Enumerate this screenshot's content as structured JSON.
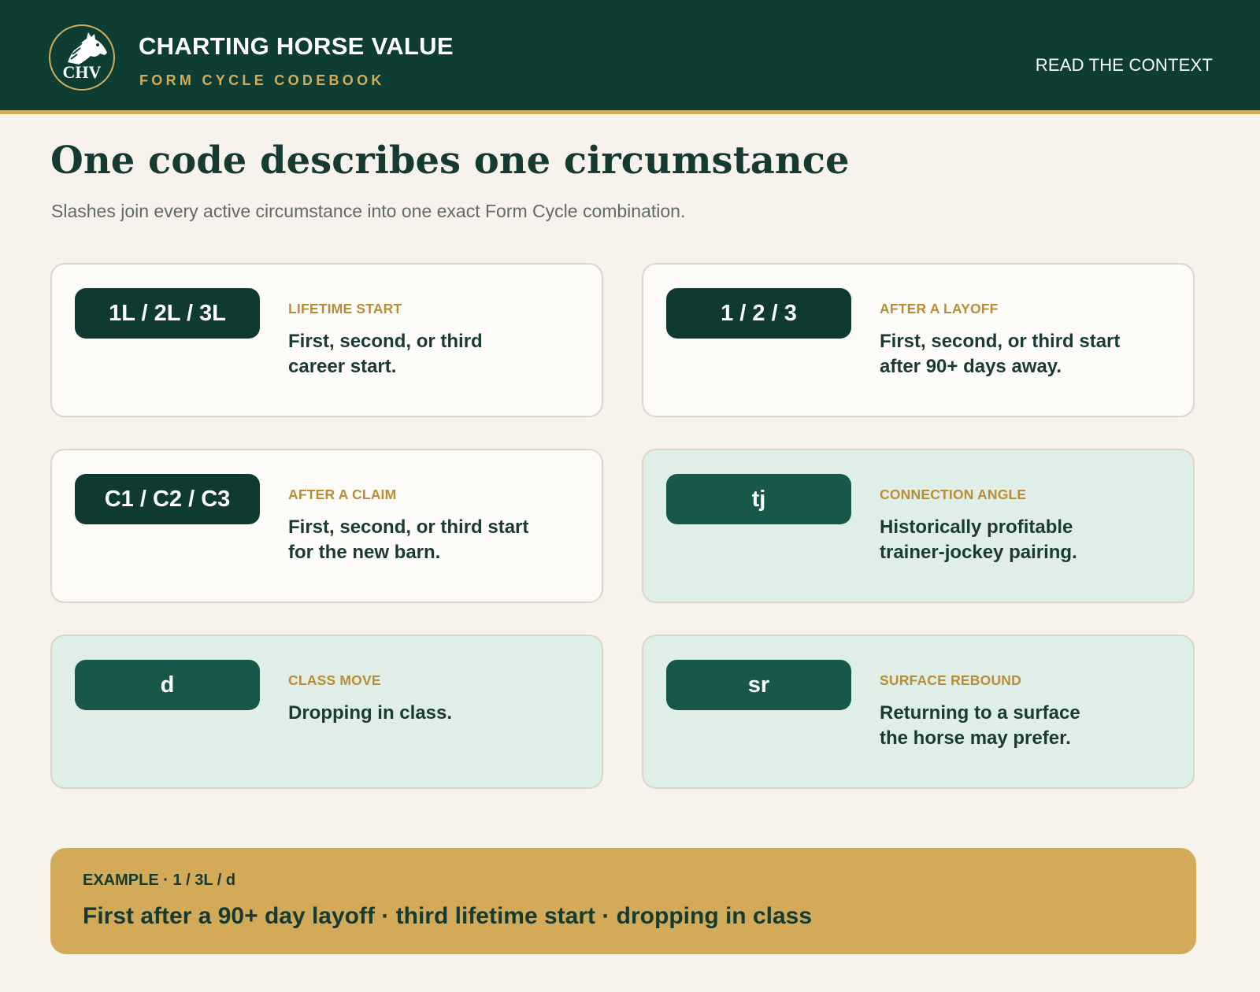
{
  "header": {
    "logo_text": "CHV",
    "title": "CHARTING HORSE VALUE",
    "subtitle": "FORM CYCLE CODEBOOK",
    "nav_link": "READ THE CONTEXT"
  },
  "main": {
    "title": "One code describes one circumstance",
    "subtitle": "Slashes join every active circumstance into one exact Form Cycle combination."
  },
  "codes": [
    {
      "code": "1L / 2L / 3L",
      "label": "LIFETIME START",
      "line1": "First, second, or third",
      "line2": "career start."
    },
    {
      "code": "1 / 2 / 3",
      "label": "AFTER A LAYOFF",
      "line1": "First, second, or third start",
      "line2": "after 90+ days away."
    },
    {
      "code": "C1 / C2 / C3",
      "label": "AFTER A CLAIM",
      "line1": "First, second, or third start",
      "line2": "for the new barn."
    },
    {
      "code": "tj",
      "label": "CONNECTION ANGLE",
      "line1": "Historically profitable",
      "line2": "trainer-jockey pairing."
    },
    {
      "code": "d",
      "label": "CLASS MOVE",
      "line1": "Dropping in class.",
      "line2": ""
    },
    {
      "code": "sr",
      "label": "SURFACE REBOUND",
      "line1": "Returning to a surface",
      "line2": "the horse may prefer."
    }
  ],
  "example": {
    "label": "EXAMPLE · 1 / 3L / d",
    "text": "First after a 90+ day layoff · third lifetime start · dropping in class"
  },
  "colors": {
    "header_bg": "#0d3d33",
    "accent_gold": "#d1ad59",
    "card_bg": "#fefcf8",
    "card_alt_bg": "#dfeee6",
    "pill_dark": "#0f3a31",
    "pill_green": "#17584a",
    "page_bg": "#f7f2eb"
  },
  "icons": {
    "logo": "horse-head-icon"
  }
}
